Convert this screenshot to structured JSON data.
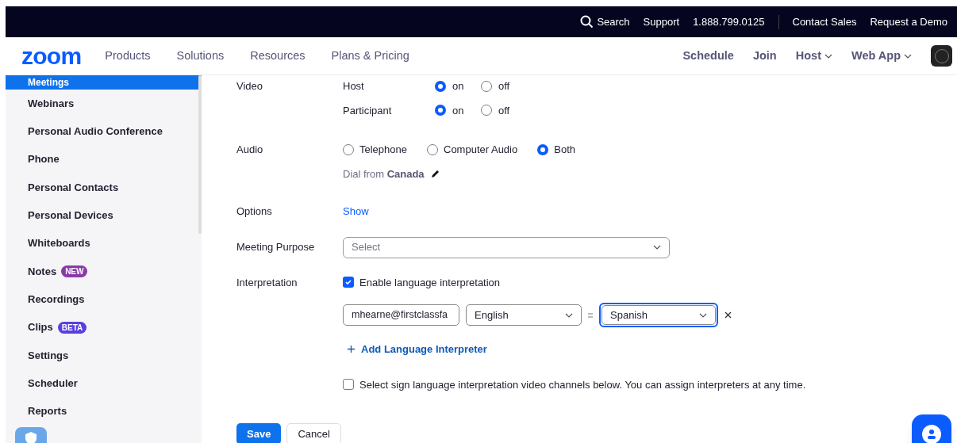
{
  "top_bar": {
    "search": "Search",
    "links": [
      "Support",
      "1.888.799.0125",
      "Contact Sales",
      "Request a Demo"
    ]
  },
  "nav": {
    "logo": "zoom",
    "items": [
      "Products",
      "Solutions",
      "Resources",
      "Plans & Pricing"
    ],
    "right": [
      {
        "label": "Schedule",
        "dropdown": false
      },
      {
        "label": "Join",
        "dropdown": false
      },
      {
        "label": "Host",
        "dropdown": true
      },
      {
        "label": "Web App",
        "dropdown": true
      }
    ]
  },
  "sidebar": {
    "items": [
      {
        "label": "Meetings",
        "selected": true
      },
      {
        "label": "Webinars",
        "selected": false
      },
      {
        "label": "Personal Audio Conference",
        "selected": false
      },
      {
        "label": "Phone",
        "selected": false
      },
      {
        "label": "Personal Contacts",
        "selected": false
      },
      {
        "label": "Personal Devices",
        "selected": false
      },
      {
        "label": "Whiteboards",
        "selected": false
      },
      {
        "label": "Notes",
        "selected": false,
        "badge": "NEW",
        "color": "#8a3aa8"
      },
      {
        "label": "Recordings",
        "selected": false
      },
      {
        "label": "Clips",
        "selected": false,
        "badge": "BETA",
        "color": "#5a3fe0"
      },
      {
        "label": "Settings",
        "selected": false
      },
      {
        "label": "Scheduler",
        "selected": false
      },
      {
        "label": "Reports",
        "selected": false
      }
    ]
  },
  "form": {
    "video": {
      "label": "Video",
      "rows": [
        {
          "label": "Host",
          "options": [
            {
              "label": "on",
              "selected": true
            },
            {
              "label": "off",
              "selected": false
            }
          ]
        },
        {
          "label": "Participant",
          "options": [
            {
              "label": "on",
              "selected": true
            },
            {
              "label": "off",
              "selected": false
            }
          ]
        }
      ]
    },
    "audio": {
      "label": "Audio",
      "options": [
        {
          "label": "Telephone",
          "selected": false
        },
        {
          "label": "Computer Audio",
          "selected": false
        },
        {
          "label": "Both",
          "selected": true
        }
      ],
      "dial_prefix": "Dial from",
      "dial_country": "Canada"
    },
    "options": {
      "label": "Options",
      "link": "Show"
    },
    "purpose": {
      "label": "Meeting Purpose",
      "placeholder": "Select"
    },
    "interpretation": {
      "label": "Interpretation",
      "enable": {
        "label": "Enable language interpretation",
        "checked": true
      },
      "interpreter": {
        "email": "mhearne@firstclassfa",
        "from": "English",
        "to": "Spanish",
        "to_focused": true
      },
      "add_link": "Add Language Interpreter",
      "sign": {
        "label": "Select sign language interpretation video channels below. You can assign interpreters at any time.",
        "checked": false
      }
    },
    "buttons": {
      "save": "Save",
      "cancel": "Cancel"
    }
  }
}
